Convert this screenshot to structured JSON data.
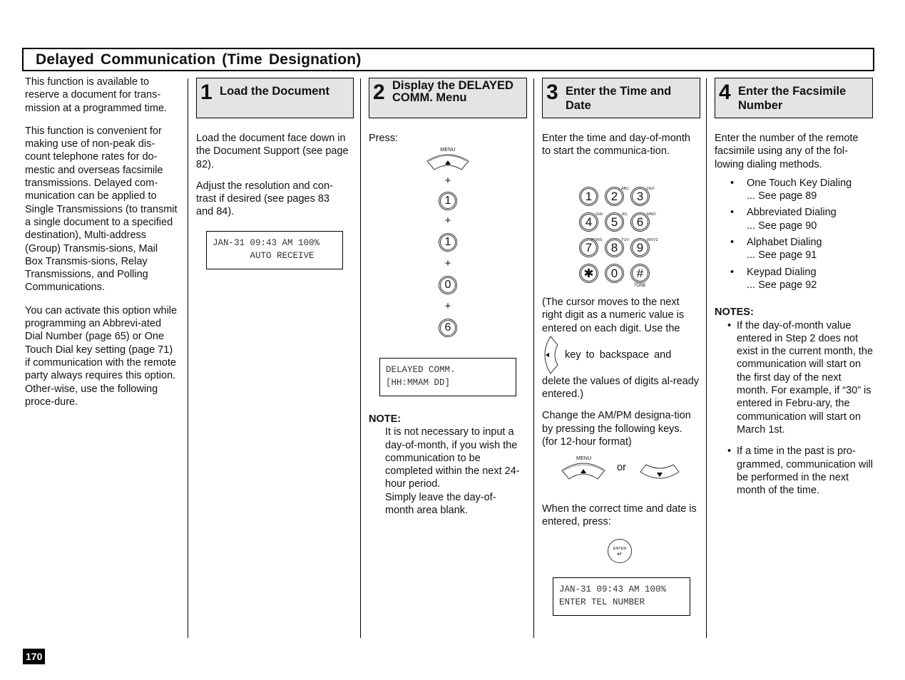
{
  "page": {
    "title": "Delayed  Communication  (Time  Designation)",
    "page_number": "170"
  },
  "intro": {
    "paragraphs": [
      "This function is available to reserve a document for trans-mission at a programmed time.",
      "This function is convenient for making use of non-peak dis-count telephone rates for do-mestic and overseas facsimile transmissions. Delayed com-munication can be applied to Single Transmissions (to transmit a single document to a specified destination), Multi-address (Group) Transmis-sions, Mail Box Transmis-sions, Relay Transmissions, and Polling Communications.",
      "You can activate this option while programming an Abbrevi-ated Dial Number (page 65)  or One Touch Dial key setting (page 71) if communication with the remote party always requires this option. Other-wise, use the following proce-dure."
    ]
  },
  "steps": [
    {
      "number": "1",
      "title": "Load the Document",
      "paragraphs": [
        "Load the document face down in the Document Support (see page 82).",
        "Adjust the resolution and con-trast if desired (see pages 83 and 84)."
      ],
      "lcd": [
        "JAN-31 09:43 AM 100%",
        "       AUTO RECEIVE"
      ]
    },
    {
      "number": "2",
      "title": "Display the DELAYED  COMM. Menu",
      "press_label": "Press:",
      "menu_key_label": "MENU",
      "plus": "+",
      "key_sequence": [
        "1",
        "1",
        "0",
        "6"
      ],
      "lcd": [
        "DELAYED COMM.",
        "[HH:MMAM DD]"
      ],
      "note_heading": "NOTE:",
      "note_text": "It is not necessary to input a day-of-month, if you wish the communication to be completed within the next 24-hour period.",
      "note_text2": "Simply leave the day-of-month area blank."
    },
    {
      "number": "3",
      "title": "Enter the Time and Date",
      "intro": "Enter the time and day-of-month to start the communica-tion.",
      "keypad": [
        [
          {
            "d": "1",
            "s": ""
          },
          {
            "d": "2",
            "s": "ABC"
          },
          {
            "d": "3",
            "s": "DEF"
          }
        ],
        [
          {
            "d": "4",
            "s": "GHI"
          },
          {
            "d": "5",
            "s": "JKL"
          },
          {
            "d": "6",
            "s": "MNO"
          }
        ],
        [
          {
            "d": "7",
            "s": "PQRS"
          },
          {
            "d": "8",
            "s": "TUV"
          },
          {
            "d": "9",
            "s": "WXYZ"
          }
        ],
        [
          {
            "d": "✱",
            "s": ""
          },
          {
            "d": "0",
            "s": ""
          },
          {
            "d": "#",
            "s": ""
          }
        ]
      ],
      "tone_label": "TONE",
      "cursor_text": "(The cursor moves to the next right digit as a numeric value is entered on each digit. Use the",
      "backspace_text": "key  to  backspace  and",
      "cursor_text2": "delete the values of digits al-ready entered.)",
      "ampm_text": "Change the AM/PM designa-tion by pressing the following keys. (for 12-hour format)",
      "menu_key_label": "MENU",
      "or_label": "or",
      "enter_text": "When the correct time and date is entered, press:",
      "enter_key_label": "ENTER",
      "lcd": [
        "JAN-31 09:43 AM 100%",
        "ENTER TEL NUMBER"
      ]
    },
    {
      "number": "4",
      "title": "Enter the Facsimile Number",
      "intro": "Enter the number of the remote facsimile using any of the fol-lowing dialing methods.",
      "methods": [
        {
          "name": "One Touch Key Dialing",
          "ref": "... See page 89"
        },
        {
          "name": "Abbreviated Dialing",
          "ref": "... See page 90"
        },
        {
          "name": "Alphabet Dialing",
          "ref": "... See page 91"
        },
        {
          "name": "Keypad Dialing",
          "ref": "... See page 92"
        }
      ],
      "notes_heading": "NOTES:",
      "notes": [
        "If the day-of-month value entered in Step 2 does not exist in the current month, the communication will start on the first day of the next month. For example, if “30” is entered in Febru-ary, the communication will start on March 1st.",
        "If a time in the past is pro-grammed,  communication will be performed in the next month of the time."
      ]
    }
  ]
}
